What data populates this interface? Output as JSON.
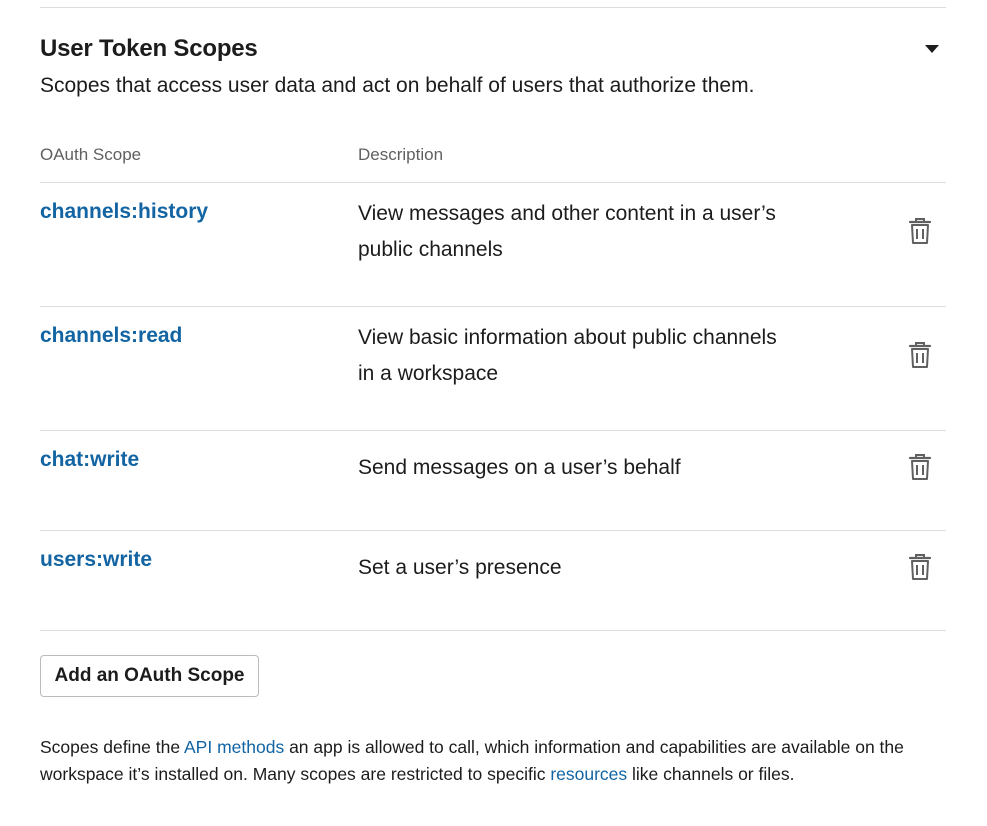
{
  "section": {
    "title": "User Token Scopes",
    "subtitle": "Scopes that access user data and act on behalf of users that authorize them."
  },
  "table": {
    "headers": {
      "scope": "OAuth Scope",
      "description": "Description"
    },
    "rows": [
      {
        "scope": "channels:history",
        "description": "View messages and other content in a user’s public channels",
        "action_icon": "trash-icon"
      },
      {
        "scope": "channels:read",
        "description": "View basic information about public channels in a workspace",
        "action_icon": "trash-icon"
      },
      {
        "scope": "chat:write",
        "description": "Send messages on a user’s behalf",
        "action_icon": "trash-icon"
      },
      {
        "scope": "users:write",
        "description": "Set a user’s presence",
        "action_icon": "trash-icon"
      }
    ]
  },
  "add_button": {
    "label": "Add an OAuth Scope"
  },
  "footnote": {
    "part1": "Scopes define the ",
    "link1": "API methods",
    "part2": " an app is allowed to call, which information and capabilities are available on the workspace it’s installed on. Many scopes are restricted to specific ",
    "link2": "resources",
    "part3": " like channels or files."
  },
  "colors": {
    "link": "#1264a3",
    "text": "#1d1c1d",
    "muted": "#616061",
    "divider": "#dddddd"
  }
}
